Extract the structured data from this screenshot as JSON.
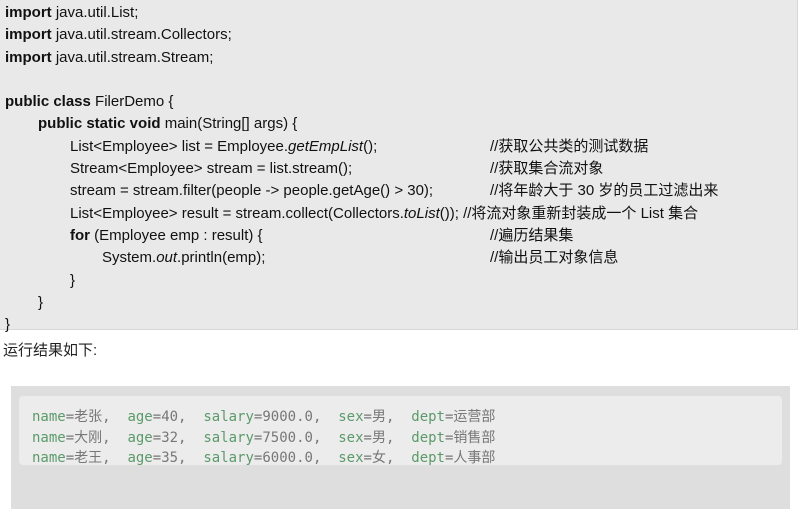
{
  "code": {
    "lines": [
      {
        "parts": [
          {
            "t": "import",
            "s": "kw"
          },
          {
            "t": " java.util.List;",
            "s": ""
          }
        ],
        "comment": "",
        "indent": 0
      },
      {
        "parts": [
          {
            "t": "import",
            "s": "kw"
          },
          {
            "t": " java.util.stream.Collectors;",
            "s": ""
          }
        ],
        "comment": "",
        "indent": 0
      },
      {
        "parts": [
          {
            "t": "import",
            "s": "kw"
          },
          {
            "t": " java.util.stream.Stream;",
            "s": ""
          }
        ],
        "comment": "",
        "indent": 0
      },
      {
        "parts": [],
        "comment": "",
        "indent": 0
      },
      {
        "parts": [
          {
            "t": "public class",
            "s": "kw"
          },
          {
            "t": " FilerDemo {",
            "s": ""
          }
        ],
        "comment": "",
        "indent": 0
      },
      {
        "parts": [
          {
            "t": "public static void",
            "s": "kw"
          },
          {
            "t": " main(String[] args) {",
            "s": ""
          }
        ],
        "comment": "",
        "indent": 1
      },
      {
        "parts": [
          {
            "t": "List<Employee> list = Employee.",
            "s": ""
          },
          {
            "t": "getEmpList",
            "s": "it"
          },
          {
            "t": "();",
            "s": ""
          }
        ],
        "comment": "//获取公共类的测试数据",
        "indent": 2
      },
      {
        "parts": [
          {
            "t": "Stream<Employee> stream = list.stream();",
            "s": ""
          }
        ],
        "comment": "//获取集合流对象",
        "indent": 2
      },
      {
        "parts": [
          {
            "t": "stream = stream.filter(people -> people.getAge() > 30);",
            "s": ""
          }
        ],
        "comment": "//将年龄大于 30 岁的员工过滤出来",
        "indent": 2
      },
      {
        "parts": [
          {
            "t": "List<Employee> result = stream.collect(Collectors.",
            "s": ""
          },
          {
            "t": "toList",
            "s": "it"
          },
          {
            "t": "()); //将流对象重新封装成一个 List 集合",
            "s": ""
          }
        ],
        "comment": "",
        "indent": 2
      },
      {
        "parts": [
          {
            "t": "for",
            "s": "kw"
          },
          {
            "t": " (Employee emp : result) {",
            "s": ""
          }
        ],
        "comment": "//遍历结果集",
        "indent": 2
      },
      {
        "parts": [
          {
            "t": "System.",
            "s": ""
          },
          {
            "t": "out",
            "s": "it"
          },
          {
            "t": ".println(emp);",
            "s": ""
          }
        ],
        "comment": "//输出员工对象信息",
        "indent": 3
      },
      {
        "parts": [
          {
            "t": "}",
            "s": ""
          }
        ],
        "comment": "",
        "indent": 2
      },
      {
        "parts": [
          {
            "t": "}",
            "s": ""
          }
        ],
        "comment": "",
        "indent": 1
      },
      {
        "parts": [
          {
            "t": "}",
            "s": ""
          }
        ],
        "comment": "",
        "indent": 0
      }
    ]
  },
  "result_heading": "运行结果如下:",
  "output": {
    "rows": [
      [
        {
          "k": "name",
          "v": "老张"
        },
        {
          "k": "age",
          "v": "40"
        },
        {
          "k": "salary",
          "v": "9000.0"
        },
        {
          "k": "sex",
          "v": "男"
        },
        {
          "k": "dept",
          "v": "运营部"
        }
      ],
      [
        {
          "k": "name",
          "v": "大刚"
        },
        {
          "k": "age",
          "v": "32"
        },
        {
          "k": "salary",
          "v": "7500.0"
        },
        {
          "k": "sex",
          "v": "男"
        },
        {
          "k": "dept",
          "v": "销售部"
        }
      ],
      [
        {
          "k": "name",
          "v": "老王"
        },
        {
          "k": "age",
          "v": "35"
        },
        {
          "k": "salary",
          "v": "6000.0"
        },
        {
          "k": "sex",
          "v": "女"
        },
        {
          "k": "dept",
          "v": "人事部"
        }
      ]
    ]
  }
}
